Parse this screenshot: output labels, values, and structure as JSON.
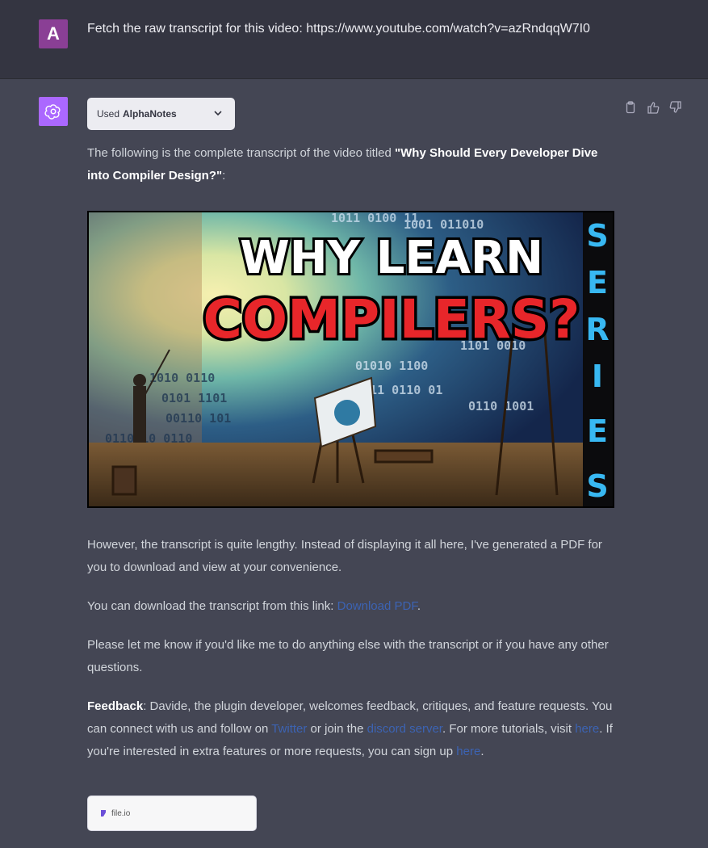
{
  "user": {
    "avatar_letter": "A",
    "message": "Fetch the raw transcript for this video: https://www.youtube.com/watch?v=azRndqqW7I0"
  },
  "assistant": {
    "plugin": {
      "prefix": "Used",
      "name": "AlphaNotes"
    },
    "intro_text": "The following is the complete transcript of the video titled ",
    "video_title": "\"Why Should Every Developer Dive into Compiler Design?\"",
    "intro_end": ":",
    "thumbnail": {
      "line1": "WHY LEARN",
      "line2": "COMPILERS?",
      "side_letters": [
        "S",
        "E",
        "R",
        "I",
        "E",
        "S"
      ]
    },
    "para_lengthy": "However, the transcript is quite lengthy. Instead of displaying it all here, I've generated a PDF for you to download and view at your convenience.",
    "download_prefix": "You can download the transcript from this link: ",
    "download_link": "Download PDF",
    "download_suffix": ".",
    "para_questions": "Please let me know if you'd like me to do anything else with the transcript or if you have any other questions.",
    "feedback": {
      "label": "Feedback",
      "text1": ": Davide, the plugin developer, welcomes feedback, critiques, and feature requests. You can connect with us and follow on ",
      "twitter": "Twitter",
      "text2": " or join the ",
      "discord": "discord server",
      "text3": ". For more tutorials, visit ",
      "here1": "here",
      "text4": ". If you're interested in extra features or more requests, you can sign up ",
      "here2": "here",
      "text5": "."
    },
    "file_card": {
      "label": "file.io"
    }
  },
  "colors": {
    "user_bg": "#343541",
    "assistant_bg": "#444654",
    "link": "#3c63b3",
    "bot_avatar": "#ab68ff",
    "user_avatar": "#8a3f95"
  },
  "icons": [
    "openai-logo-icon",
    "chevron-down-icon",
    "clipboard-icon",
    "thumbs-up-icon",
    "thumbs-down-icon",
    "file-io-icon"
  ]
}
